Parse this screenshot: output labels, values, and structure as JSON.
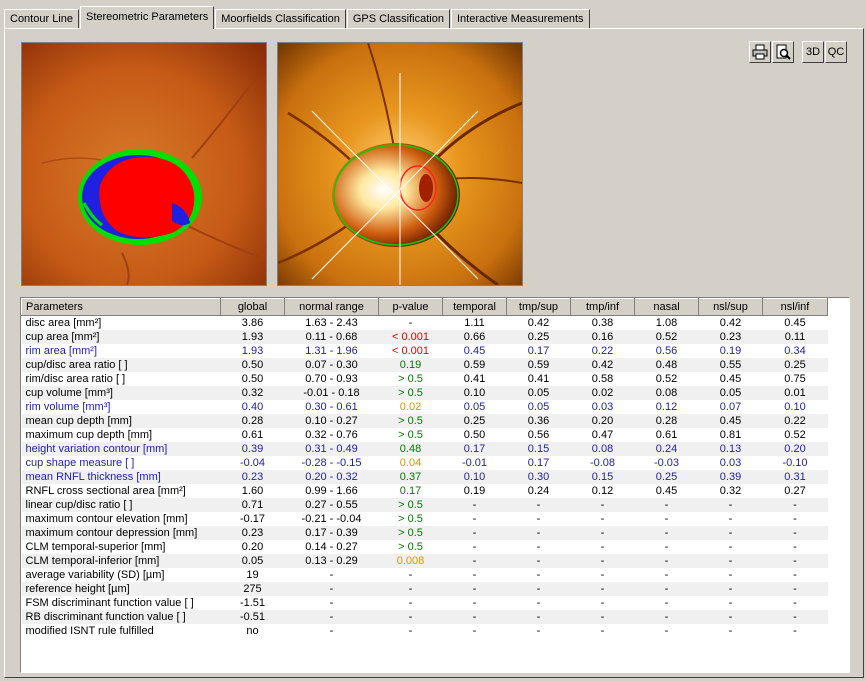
{
  "tabs": [
    "Contour Line",
    "Stereometric Parameters",
    "Moorfields Classification",
    "GPS Classification",
    "Interactive Measurements"
  ],
  "active_tab": 1,
  "toolbar": {
    "btn_3d": "3D",
    "btn_qc": "QC"
  },
  "colors": {
    "blue_row": "#1f1f9f",
    "red": "#e00000",
    "green": "#007a00",
    "orange": "#d49a00"
  },
  "table": {
    "headers": [
      "Parameters",
      "global",
      "normal range",
      "p-value",
      "temporal",
      "tmp/sup",
      "tmp/inf",
      "nasal",
      "nsl/sup",
      "nsl/inf"
    ],
    "rows": [
      {
        "name": "disc area [mm²]",
        "global": "3.86",
        "range": "1.63 -  2.43",
        "p": "-",
        "pc": "",
        "t": "1.11",
        "ts": "0.42",
        "ti": "0.38",
        "n": "1.08",
        "ns": "0.42",
        "ni": "0.45",
        "hl": false
      },
      {
        "name": "cup area [mm²]",
        "global": "1.93",
        "range": "0.11 -  0.68",
        "p": "< 0.001",
        "pc": "red",
        "t": "0.66",
        "ts": "0.25",
        "ti": "0.16",
        "n": "0.52",
        "ns": "0.23",
        "ni": "0.11",
        "hl": false
      },
      {
        "name": "rim area [mm²]",
        "global": "1.93",
        "range": "1.31 -  1.96",
        "p": "< 0.001",
        "pc": "red",
        "t": "0.45",
        "ts": "0.17",
        "ti": "0.22",
        "n": "0.56",
        "ns": "0.19",
        "ni": "0.34",
        "hl": true
      },
      {
        "name": "cup/disc area ratio [ ]",
        "global": "0.50",
        "range": "0.07 -  0.30",
        "p": "0.19",
        "pc": "green",
        "t": "0.59",
        "ts": "0.59",
        "ti": "0.42",
        "n": "0.48",
        "ns": "0.55",
        "ni": "0.25",
        "hl": false
      },
      {
        "name": "rim/disc area ratio [ ]",
        "global": "0.50",
        "range": "0.70 -  0.93",
        "p": "> 0.5",
        "pc": "green",
        "t": "0.41",
        "ts": "0.41",
        "ti": "0.58",
        "n": "0.52",
        "ns": "0.45",
        "ni": "0.75",
        "hl": false
      },
      {
        "name": "cup volume [mm³]",
        "global": "0.32",
        "range": "-0.01 -  0.18",
        "p": "> 0.5",
        "pc": "green",
        "t": "0.10",
        "ts": "0.05",
        "ti": "0.02",
        "n": "0.08",
        "ns": "0.05",
        "ni": "0.01",
        "hl": false
      },
      {
        "name": "rim volume [mm³]",
        "global": "0.40",
        "range": "0.30 -  0.61",
        "p": "0.02",
        "pc": "orange",
        "t": "0.05",
        "ts": "0.05",
        "ti": "0.03",
        "n": "0.12",
        "ns": "0.07",
        "ni": "0.10",
        "hl": true
      },
      {
        "name": "mean cup depth [mm]",
        "global": "0.28",
        "range": "0.10 -  0.27",
        "p": "> 0.5",
        "pc": "green",
        "t": "0.25",
        "ts": "0.36",
        "ti": "0.20",
        "n": "0.28",
        "ns": "0.45",
        "ni": "0.22",
        "hl": false
      },
      {
        "name": "maximum cup depth [mm]",
        "global": "0.61",
        "range": "0.32 -  0.76",
        "p": "> 0.5",
        "pc": "green",
        "t": "0.50",
        "ts": "0.56",
        "ti": "0.47",
        "n": "0.61",
        "ns": "0.81",
        "ni": "0.52",
        "hl": false
      },
      {
        "name": "height variation contour [mm]",
        "global": "0.39",
        "range": "0.31 -  0.49",
        "p": "0.48",
        "pc": "green",
        "t": "0.17",
        "ts": "0.15",
        "ti": "0.08",
        "n": "0.24",
        "ns": "0.13",
        "ni": "0.20",
        "hl": true
      },
      {
        "name": "cup shape measure [ ]",
        "global": "-0.04",
        "range": "-0.28 -  -0.15",
        "p": "0.04",
        "pc": "orange",
        "t": "-0.01",
        "ts": "0.17",
        "ti": "-0.08",
        "n": "-0.03",
        "ns": "0.03",
        "ni": "-0.10",
        "hl": true
      },
      {
        "name": "mean RNFL thickness [mm]",
        "global": "0.23",
        "range": "0.20 -  0.32",
        "p": "0.37",
        "pc": "green",
        "t": "0.10",
        "ts": "0.30",
        "ti": "0.15",
        "n": "0.25",
        "ns": "0.39",
        "ni": "0.31",
        "hl": true
      },
      {
        "name": "RNFL cross sectional area [mm²]",
        "global": "1.60",
        "range": "0.99 -  1.66",
        "p": "0.17",
        "pc": "green",
        "t": "0.19",
        "ts": "0.24",
        "ti": "0.12",
        "n": "0.45",
        "ns": "0.32",
        "ni": "0.27",
        "hl": false
      },
      {
        "name": "linear cup/disc ratio [ ]",
        "global": "0.71",
        "range": "0.27 -  0.55",
        "p": "> 0.5",
        "pc": "green",
        "t": "-",
        "ts": "-",
        "ti": "-",
        "n": "-",
        "ns": "-",
        "ni": "-",
        "hl": false
      },
      {
        "name": "maximum contour elevation [mm]",
        "global": "-0.17",
        "range": "-0.21 -  -0.04",
        "p": "> 0.5",
        "pc": "green",
        "t": "-",
        "ts": "-",
        "ti": "-",
        "n": "-",
        "ns": "-",
        "ni": "-",
        "hl": false
      },
      {
        "name": "maximum contour depression [mm]",
        "global": "0.23",
        "range": "0.17 -  0.39",
        "p": "> 0.5",
        "pc": "green",
        "t": "-",
        "ts": "-",
        "ti": "-",
        "n": "-",
        "ns": "-",
        "ni": "-",
        "hl": false
      },
      {
        "name": "CLM temporal-superior [mm]",
        "global": "0.20",
        "range": "0.14 -  0.27",
        "p": "> 0.5",
        "pc": "green",
        "t": "-",
        "ts": "-",
        "ti": "-",
        "n": "-",
        "ns": "-",
        "ni": "-",
        "hl": false
      },
      {
        "name": "CLM temporal-inferior [mm]",
        "global": "0.05",
        "range": "0.13 -  0.29",
        "p": "0.008",
        "pc": "orange",
        "t": "-",
        "ts": "-",
        "ti": "-",
        "n": "-",
        "ns": "-",
        "ni": "-",
        "hl": false
      },
      {
        "name": "average variability (SD) [µm]",
        "global": "19",
        "range": "-",
        "p": "-",
        "pc": "",
        "t": "-",
        "ts": "-",
        "ti": "-",
        "n": "-",
        "ns": "-",
        "ni": "-",
        "hl": false
      },
      {
        "name": "reference height [µm]",
        "global": "275",
        "range": "-",
        "p": "-",
        "pc": "",
        "t": "-",
        "ts": "-",
        "ti": "-",
        "n": "-",
        "ns": "-",
        "ni": "-",
        "hl": false
      },
      {
        "name": "FSM discriminant function value [ ]",
        "global": "-1.51",
        "range": "-",
        "p": "-",
        "pc": "",
        "t": "-",
        "ts": "-",
        "ti": "-",
        "n": "-",
        "ns": "-",
        "ni": "-",
        "hl": false
      },
      {
        "name": "RB discriminant function value [ ]",
        "global": "-0.51",
        "range": "-",
        "p": "-",
        "pc": "",
        "t": "-",
        "ts": "-",
        "ti": "-",
        "n": "-",
        "ns": "-",
        "ni": "-",
        "hl": false
      },
      {
        "name": "modified ISNT rule fulfilled",
        "global": "no",
        "range": "-",
        "p": "-",
        "pc": "",
        "t": "-",
        "ts": "-",
        "ti": "-",
        "n": "-",
        "ns": "-",
        "ni": "-",
        "hl": false
      }
    ]
  }
}
